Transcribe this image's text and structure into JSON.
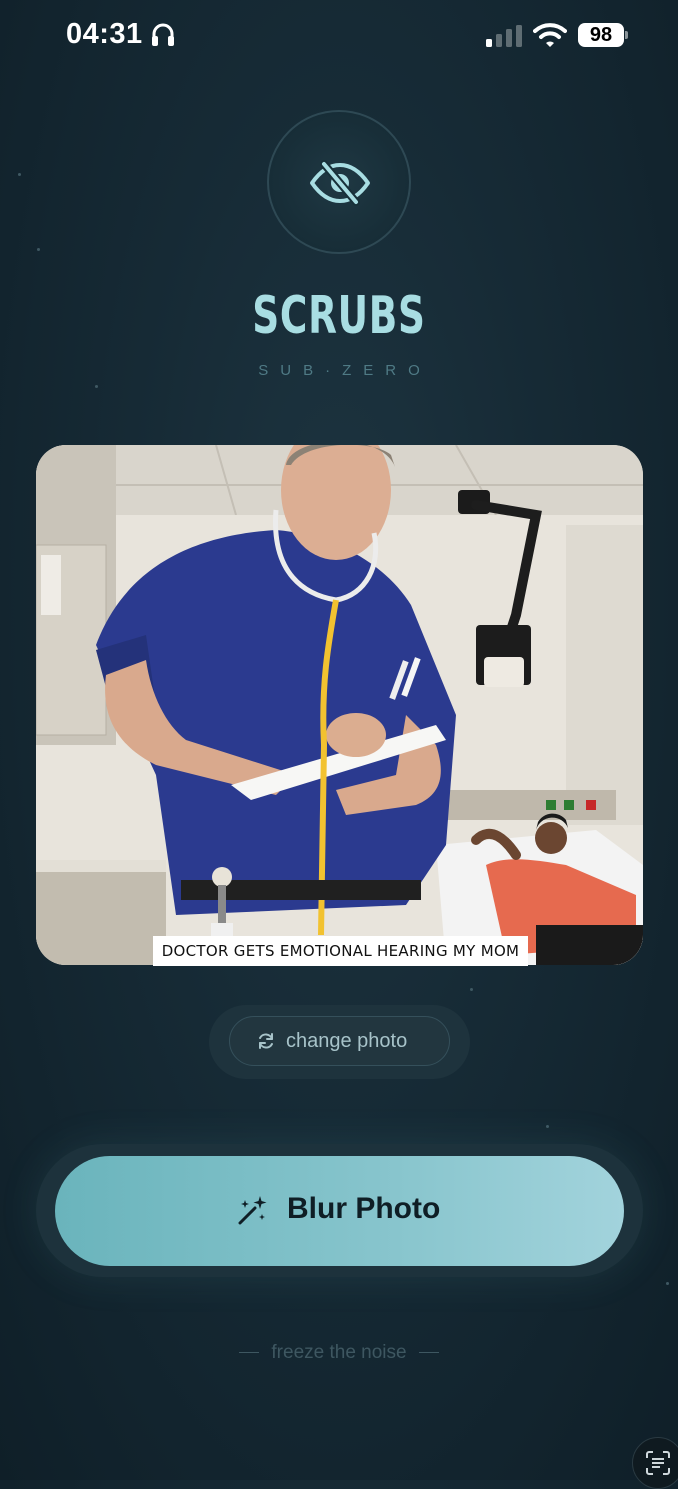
{
  "status_bar": {
    "time": "04:31",
    "battery": "98"
  },
  "brand": {
    "icon": "eye-slash-icon",
    "title": "SCRUBS",
    "subtitle": "SUB·ZERO"
  },
  "photo": {
    "caption": "DOCTOR GETS EMOTIONAL HEARING MY MOM"
  },
  "actions": {
    "change_photo_label": "change photo",
    "blur_photo_label": "Blur Photo"
  },
  "tagline": "freeze the noise",
  "colors": {
    "accent": "#a8dde2",
    "button_gradient_start": "#6ab4bc",
    "button_gradient_end": "#a2d3dc",
    "background": "#162a35"
  }
}
